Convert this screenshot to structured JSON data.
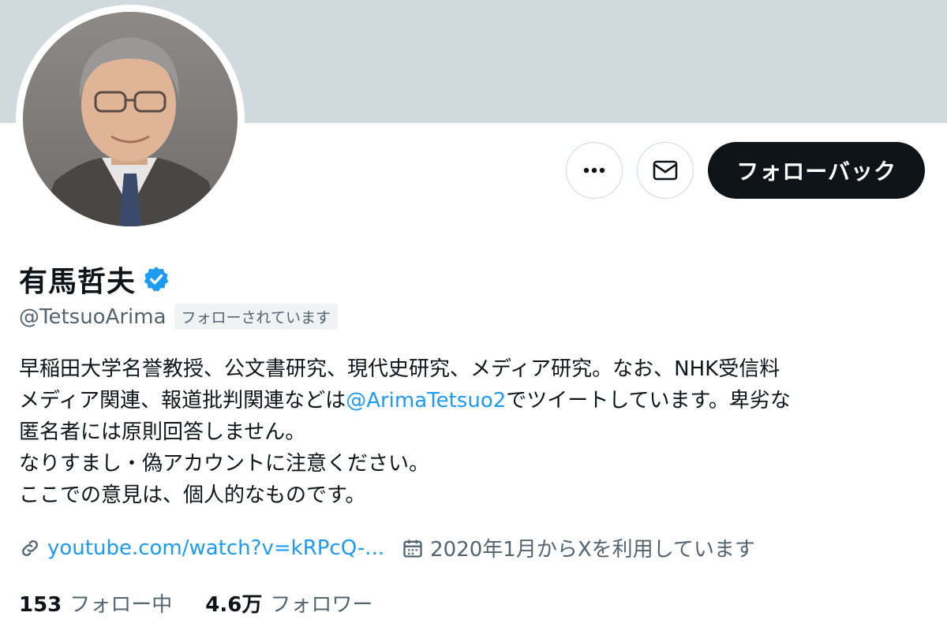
{
  "profile": {
    "display_name": "有馬哲夫",
    "handle": "@TetsuoArima",
    "follows_you": "フォローされています",
    "verified_color": "#1d9bf0"
  },
  "actions": {
    "more_icon": "more-horizontal-icon",
    "message_icon": "envelope-icon",
    "follow_back_label": "フォローバック"
  },
  "bio": {
    "line1": "早稲田大学名誉教授、公文書研究、現代史研究、メディア研究。なお、NHK受信料",
    "line2_before": "メディア関連、報道批判関連などは",
    "line2_mention": "@ArimaTetsuo2",
    "line2_after": "でツイートしています。卑劣な",
    "line3": "匿名者には原則回答しません。",
    "line4": "なりすまし・偽アカウントに注意ください。",
    "line5": "ここでの意見は、個人的なものです。"
  },
  "meta": {
    "link_icon": "link-icon",
    "link_text": "youtube.com/watch?v=kRPcQ-...",
    "calendar_icon": "calendar-icon",
    "joined_text": "2020年1月からXを利用しています"
  },
  "stats": {
    "following_count": "153",
    "following_label": "フォロー中",
    "followers_count": "4.6万",
    "followers_label": "フォロワー"
  },
  "colors": {
    "banner": "#cfd9de",
    "accent": "#1d9bf0",
    "primary_text": "#0f1419",
    "secondary_text": "#536471"
  }
}
